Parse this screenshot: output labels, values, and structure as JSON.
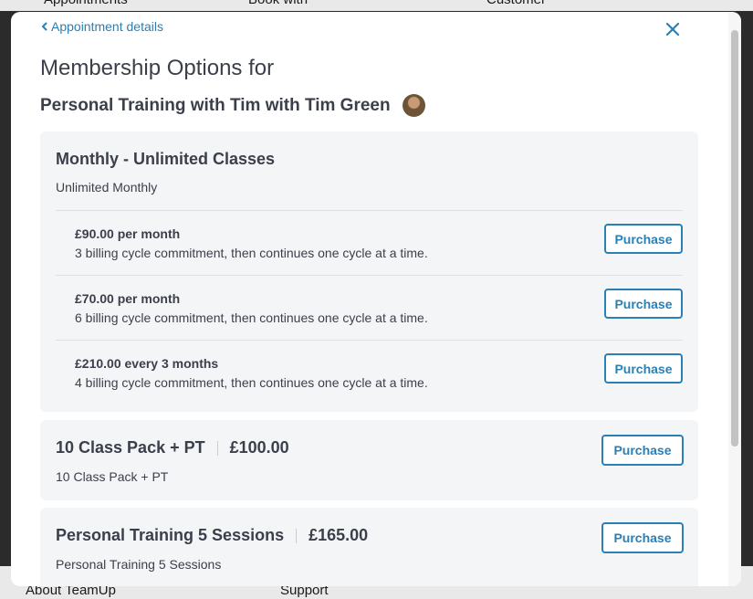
{
  "background": {
    "top_labels": [
      "Appointments",
      "Book with",
      "Customer"
    ],
    "bottom_labels": [
      "About TeamUp",
      "Support"
    ]
  },
  "modal": {
    "back_link": "Appointment details",
    "title_line1": "Membership Options for",
    "title_line2": "Personal Training with Tim with Tim Green",
    "accent_color": "#2a7fb5"
  },
  "memberships": [
    {
      "title": "Monthly - Unlimited Classes",
      "subtitle": "Unlimited Monthly",
      "options": [
        {
          "price": "£90.00 per month",
          "description": "3 billing cycle commitment, then continues one cycle at a time.",
          "button": "Purchase"
        },
        {
          "price": "£70.00 per month",
          "description": "6 billing cycle commitment, then continues one cycle at a time.",
          "button": "Purchase"
        },
        {
          "price": "£210.00 every 3 months",
          "description": "4 billing cycle commitment, then continues one cycle at a time.",
          "button": "Purchase"
        }
      ]
    },
    {
      "title": "10 Class Pack + PT",
      "price": "£100.00",
      "subtitle": "10 Class Pack + PT",
      "button": "Purchase"
    },
    {
      "title": "Personal Training 5 Sessions",
      "price": "£165.00",
      "subtitle": "Personal Training 5 Sessions",
      "button": "Purchase"
    }
  ]
}
